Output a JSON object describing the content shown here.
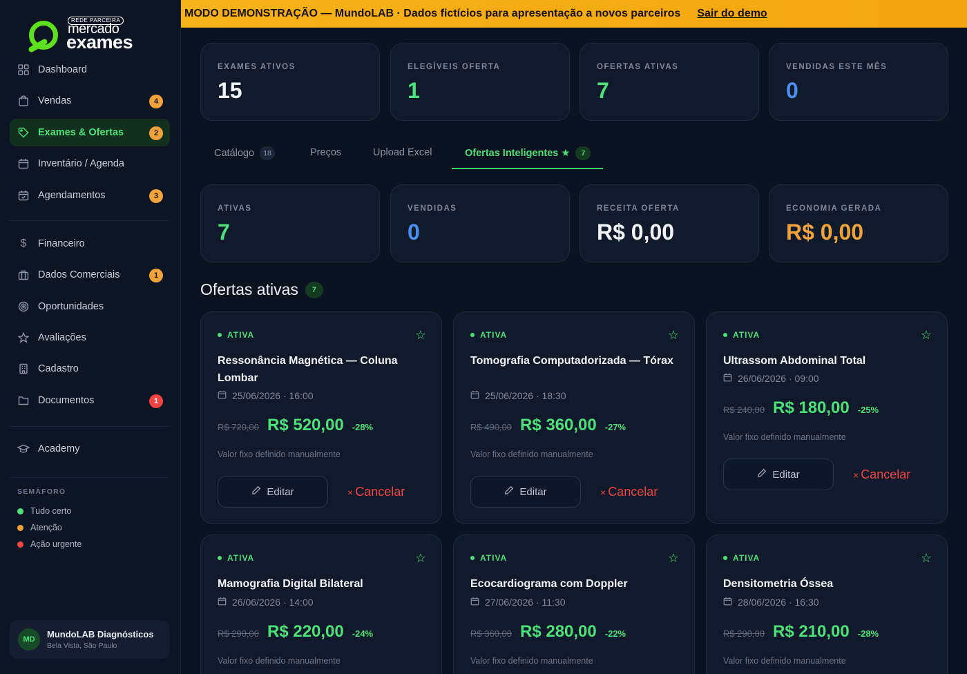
{
  "brand": {
    "top_tag": "REDE PARCEIRA",
    "line1": "mercado",
    "line2": "exames"
  },
  "banner": {
    "text": "MODO DEMONSTRAÇÃO — MundoLAB · Dados fictícios para apresentação a novos parceiros",
    "link": "Sair do demo"
  },
  "sidebar": {
    "items": [
      {
        "label": "Dashboard",
        "icon": "grid-icon"
      },
      {
        "label": "Vendas",
        "icon": "shopping-bag-icon",
        "badge": "4"
      },
      {
        "label": "Exames & Ofertas",
        "icon": "tag-icon",
        "badge": "2"
      },
      {
        "label": "Inventário / Agenda",
        "icon": "calendar-icon"
      },
      {
        "label": "Agendamentos",
        "icon": "calendar-check-icon",
        "badge": "3"
      },
      {
        "label": "Financeiro",
        "icon": "dollar-icon"
      },
      {
        "label": "Dados Comerciais",
        "icon": "briefcase-icon",
        "badge": "1"
      },
      {
        "label": "Oportunidades",
        "icon": "target-icon"
      },
      {
        "label": "Avaliações",
        "icon": "star-icon"
      },
      {
        "label": "Cadastro",
        "icon": "building-icon"
      },
      {
        "label": "Documentos",
        "icon": "folder-icon",
        "badge": "1"
      },
      {
        "label": "Academy",
        "icon": "graduation-cap-icon"
      }
    ],
    "semaforo": {
      "title": "SEMÁFORO",
      "items": [
        "Tudo certo",
        "Atenção",
        "Ação urgente"
      ]
    },
    "user": {
      "initials": "MD",
      "name": "MundoLAB Diagnósticos",
      "location": "Bela Vista, São Paulo"
    }
  },
  "top_stats": [
    {
      "label": "EXAMES ATIVOS",
      "value": "15"
    },
    {
      "label": "ELEGÍVEIS OFERTA",
      "value": "1"
    },
    {
      "label": "OFERTAS ATIVAS",
      "value": "7"
    },
    {
      "label": "VENDIDAS ESTE MÊS",
      "value": "0"
    }
  ],
  "tabs": [
    {
      "label": "Catálogo",
      "count": "18"
    },
    {
      "label": "Preços"
    },
    {
      "label": "Upload Excel"
    },
    {
      "label": "Ofertas Inteligentes ★",
      "count": "7"
    }
  ],
  "offer_stats": [
    {
      "label": "ATIVAS",
      "value": "7"
    },
    {
      "label": "VENDIDAS",
      "value": "0"
    },
    {
      "label": "RECEITA OFERTA",
      "value": "R$ 0,00"
    },
    {
      "label": "ECONOMIA GERADA",
      "value": "R$ 0,00"
    }
  ],
  "section": {
    "title": "Ofertas ativas",
    "count": "7"
  },
  "offers": [
    {
      "status": "ATIVA",
      "title": "Ressonância Magnética — Coluna Lombar",
      "date": "25/06/2026 · 16:00",
      "old_price": "R$ 720,00",
      "new_price": "R$ 520,00",
      "discount": "-28%",
      "note": "Valor fixo definido manualmente",
      "edit": "Editar",
      "cancel": "Cancelar"
    },
    {
      "status": "ATIVA",
      "title": "Tomografia Computadorizada — Tórax",
      "date": "25/06/2026 · 18:30",
      "old_price": "R$ 490,00",
      "new_price": "R$ 360,00",
      "discount": "-27%",
      "note": "Valor fixo definido manualmente",
      "edit": "Editar",
      "cancel": "Cancelar"
    },
    {
      "status": "ATIVA",
      "title": "Ultrassom Abdominal Total",
      "date": "26/06/2026 · 09:00",
      "old_price": "R$ 240,00",
      "new_price": "R$ 180,00",
      "discount": "-25%",
      "note": "Valor fixo definido manualmente",
      "edit": "Editar",
      "cancel": "Cancelar"
    },
    {
      "status": "ATIVA",
      "title": "Mamografia Digital Bilateral",
      "date": "26/06/2026 · 14:00",
      "old_price": "R$ 290,00",
      "new_price": "R$ 220,00",
      "discount": "-24%",
      "note": "Valor fixo definido manualmente"
    },
    {
      "status": "ATIVA",
      "title": "Ecocardiograma com Doppler",
      "date": "27/06/2026 · 11:30",
      "old_price": "R$ 360,00",
      "new_price": "R$ 280,00",
      "discount": "-22%",
      "note": "Valor fixo definido manualmente"
    },
    {
      "status": "ATIVA",
      "title": "Densitometria Óssea",
      "date": "28/06/2026 · 16:30",
      "old_price": "R$ 290,00",
      "new_price": "R$ 210,00",
      "discount": "-28%",
      "note": "Valor fixo definido manualmente"
    }
  ],
  "colors": {
    "accent_green": "#4ee07a",
    "warning_orange": "#f0a33a",
    "danger_red": "#f04444",
    "info_blue": "#4a8ff0",
    "banner_yellow": "#f6b21a"
  }
}
